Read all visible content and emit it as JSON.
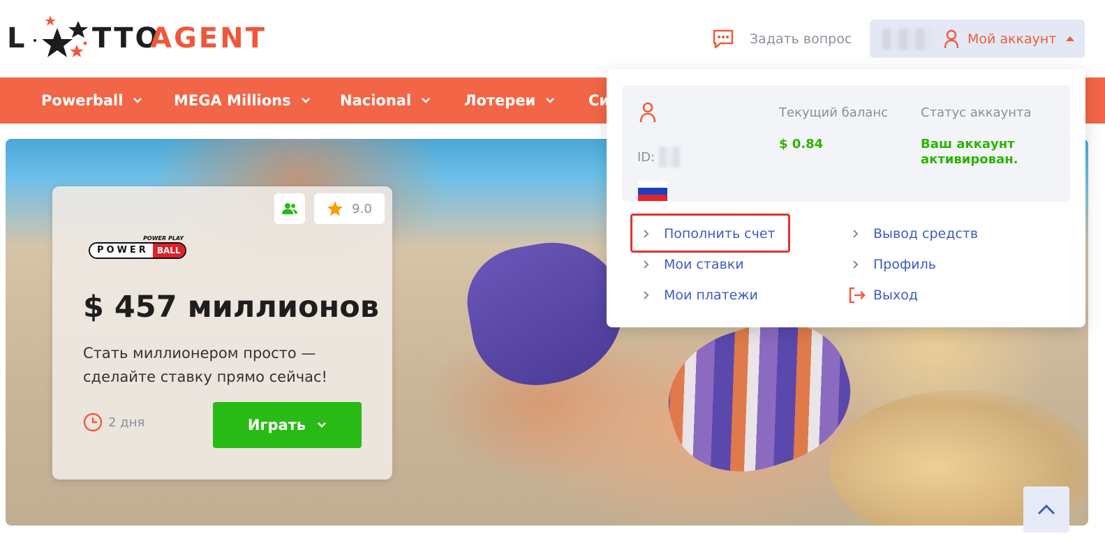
{
  "header": {
    "logo": {
      "letter_l": "L",
      "tto": "TTO",
      "agent": "AGENT"
    },
    "ask_question": "Задать вопрос",
    "account_label": "Мой аккаунт"
  },
  "nav": {
    "items": [
      {
        "label": "Powerball"
      },
      {
        "label": "MEGA Millions"
      },
      {
        "label": "Nacional"
      },
      {
        "label": "Лотереи"
      },
      {
        "label": "Си"
      }
    ]
  },
  "account_menu": {
    "id_label": "ID:",
    "balance_title": "Текущий баланс",
    "balance_value": "$ 0.84",
    "status_title": "Статус аккаунта",
    "status_value": "Ваш аккаунт активирован.",
    "links_left": [
      "Пополнить счет",
      "Мои ставки",
      "Мои платежи"
    ],
    "links_right": [
      "Вывод средств",
      "Профиль",
      "Выход"
    ]
  },
  "promo": {
    "rating": "9.0",
    "lottery_logo": {
      "power_play": "POWER PLAY",
      "power": "POWER",
      "ball": "BALL"
    },
    "jackpot": "$ 457 миллионов",
    "description": "Стать миллионером просто — сделайте ставку прямо сейчас!",
    "time_left": "2 дня",
    "play_button": "Играть"
  },
  "colors": {
    "brand_orange": "#f26546",
    "link_blue": "#3b5cc4",
    "success_green": "#2cb400",
    "play_green": "#28bb16",
    "highlight_red": "#e2322e"
  },
  "icons": [
    "chat-icon",
    "user-icon",
    "caret-up-icon",
    "chevron-down-icon",
    "chevron-right-icon",
    "logout-icon",
    "users-icon",
    "star-icon",
    "clock-icon",
    "arrow-up-icon",
    "flag-russia-icon"
  ]
}
